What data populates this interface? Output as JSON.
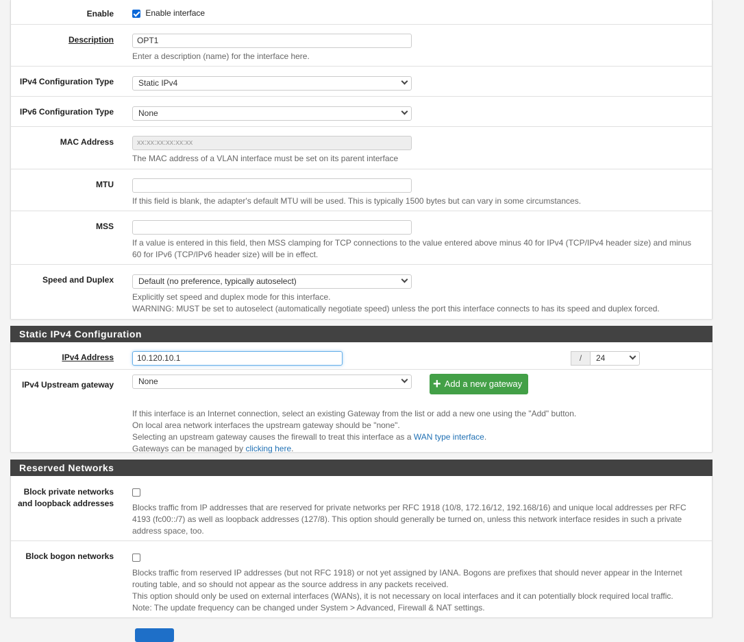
{
  "general": {
    "enable": {
      "label": "Enable",
      "checkbox_label": "Enable interface",
      "checked": true
    },
    "description": {
      "label": "Description",
      "value": "OPT1",
      "help": "Enter a description (name) for the interface here."
    },
    "ipv4_type": {
      "label": "IPv4 Configuration Type",
      "selected": "Static IPv4"
    },
    "ipv6_type": {
      "label": "IPv6 Configuration Type",
      "selected": "None"
    },
    "mac": {
      "label": "MAC Address",
      "placeholder": "xx:xx:xx:xx:xx:xx",
      "help": "The MAC address of a VLAN interface must be set on its parent interface"
    },
    "mtu": {
      "label": "MTU",
      "value": "",
      "help": "If this field is blank, the adapter's default MTU will be used. This is typically 1500 bytes but can vary in some circumstances."
    },
    "mss": {
      "label": "MSS",
      "value": "",
      "help": "If a value is entered in this field, then MSS clamping for TCP connections to the value entered above minus 40 for IPv4 (TCP/IPv4 header size) and minus 60 for IPv6 (TCP/IPv6 header size) will be in effect."
    },
    "speed": {
      "label": "Speed and Duplex",
      "selected": "Default (no preference, typically autoselect)",
      "help1": "Explicitly set speed and duplex mode for this interface.",
      "help2": "WARNING: MUST be set to autoselect (automatically negotiate speed) unless the port this interface connects to has its speed and duplex forced."
    }
  },
  "static_ipv4": {
    "title": "Static IPv4 Configuration",
    "address": {
      "label": "IPv4 Address",
      "value": "10.120.10.1",
      "separator": "/",
      "cidr": "24"
    },
    "gateway": {
      "label": "IPv4 Upstream gateway",
      "selected": "None",
      "add_button": "Add a new gateway",
      "help1": "If this interface is an Internet connection, select an existing Gateway from the list or add a new one using the \"Add\" button.",
      "help2": "On local area network interfaces the upstream gateway should be \"none\".",
      "help3_prefix": "Selecting an upstream gateway causes the firewall to treat this interface as a ",
      "help3_link": "WAN type interface",
      "help3_suffix": ".",
      "help4_prefix": "Gateways can be managed by ",
      "help4_link": "clicking here",
      "help4_suffix": "."
    }
  },
  "reserved": {
    "title": "Reserved Networks",
    "private": {
      "label_line1": "Block private networks",
      "label_line2": "and loopback addresses",
      "checked": false,
      "help": "Blocks traffic from IP addresses that are reserved for private networks per RFC 1918 (10/8, 172.16/12, 192.168/16) and unique local addresses per RFC 4193 (fc00::/7) as well as loopback addresses (127/8). This option should generally be turned on, unless this network interface resides in such a private address space, too."
    },
    "bogon": {
      "label": "Block bogon networks",
      "checked": false,
      "help1": "Blocks traffic from reserved IP addresses (but not RFC 1918) or not yet assigned by IANA. Bogons are prefixes that should never appear in the Internet routing table, and so should not appear as the source address in any packets received.",
      "help2": "This option should only be used on external interfaces (WANs), it is not necessary on local interfaces and it can potentially block required local traffic.",
      "help3": "Note: The update frequency can be changed under System > Advanced, Firewall & NAT settings."
    }
  },
  "colors": {
    "section_header": "#424242",
    "accent_green": "#43a047",
    "link": "#1e6fb3",
    "primary": "#1e6fc8"
  }
}
